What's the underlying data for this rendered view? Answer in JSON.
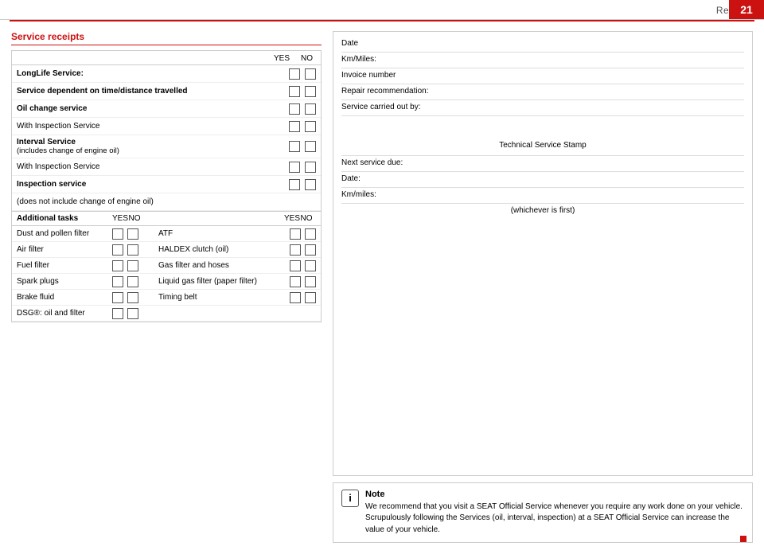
{
  "header": {
    "title": "Records",
    "page_number": "21"
  },
  "left": {
    "section_title": "Service receipts",
    "table_header": {
      "yes": "YES",
      "no": "NO"
    },
    "service_rows": [
      {
        "label": "LongLife Service:",
        "bold": true,
        "has_checkboxes": true
      },
      {
        "label": "Service dependent on time/distance travelled",
        "bold": true,
        "has_checkboxes": true
      },
      {
        "label": "Oil change service",
        "bold": true,
        "has_checkboxes": true
      },
      {
        "label": "With Inspection Service",
        "bold": false,
        "has_checkboxes": true
      },
      {
        "label": "Interval Service\n(includes change of engine oil)",
        "bold": true,
        "has_checkboxes": true
      },
      {
        "label": "With Inspection Service",
        "bold": false,
        "has_checkboxes": true
      },
      {
        "label": "Inspection service",
        "bold": true,
        "has_checkboxes": true
      },
      {
        "label": "(does not include change of engine oil)",
        "bold": false,
        "has_checkboxes": false
      }
    ],
    "additional": {
      "header_label": "Additional tasks",
      "yes": "YES",
      "no": "NO",
      "yes2": "YES",
      "no2": "NO",
      "rows": [
        {
          "left": "Dust and pollen filter",
          "right": "ATF"
        },
        {
          "left": "Air filter",
          "right": "HALDEX clutch (oil)"
        },
        {
          "left": "Fuel filter",
          "right": "Gas filter and hoses"
        },
        {
          "left": "Spark plugs",
          "right": "Liquid gas filter (paper filter)"
        },
        {
          "left": "Brake fluid",
          "right": "Timing belt"
        },
        {
          "left": "DSG®: oil and filter",
          "right": ""
        }
      ]
    }
  },
  "right": {
    "info_fields": [
      {
        "label": "Date",
        "tall": false
      },
      {
        "label": "Km/Miles:",
        "tall": false
      },
      {
        "label": "Invoice number",
        "tall": false
      },
      {
        "label": "Repair recommendation:",
        "tall": false
      },
      {
        "label": "Service carried out by:",
        "tall": false
      },
      {
        "label": "",
        "tall": true,
        "stamp_text": "Technical Service Stamp"
      },
      {
        "label": "Next service due:",
        "tall": false
      },
      {
        "label": "Date:",
        "tall": false
      },
      {
        "label": "Km/miles:",
        "tall": false
      },
      {
        "label": "(whichever is first)",
        "tall": false,
        "centered": true
      }
    ],
    "note": {
      "icon": "i",
      "title": "Note",
      "text": "We recommend that you visit a SEAT Official Service whenever you require any work done on your vehicle. Scrupulously following the Services (oil, interval, inspection) at a SEAT Official Service can increase the value of your vehicle."
    }
  }
}
